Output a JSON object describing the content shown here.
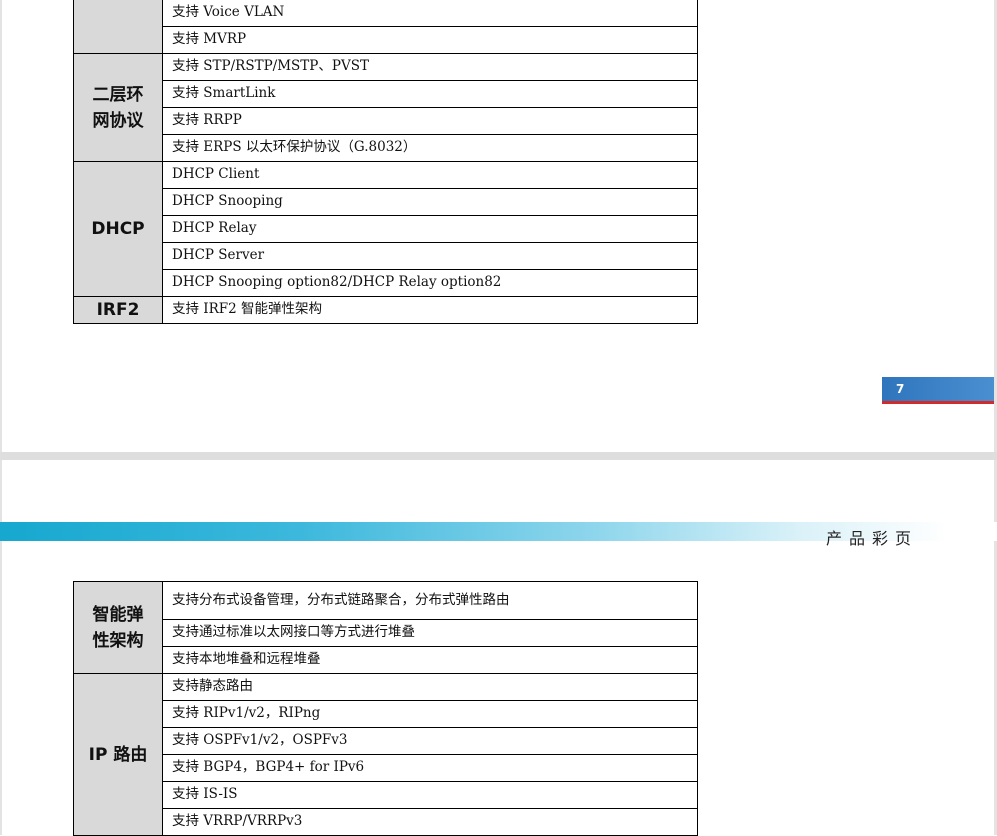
{
  "top_page": {
    "rows": [
      {
        "category": "",
        "items": [
          "支持 Voice VLAN",
          "支持 MVRP"
        ]
      },
      {
        "category": "二层环网协议",
        "items": [
          "支持 STP/RSTP/MSTP、PVST",
          "支持 SmartLink",
          "支持 RRPP",
          "支持 ERPS 以太环保护协议（G.8032）"
        ]
      },
      {
        "category": "DHCP",
        "items": [
          "DHCP Client",
          "DHCP Snooping",
          "DHCP Relay",
          "DHCP Server",
          "DHCP Snooping option82/DHCP Relay option82"
        ]
      },
      {
        "category": "IRF2",
        "items": [
          "支持 IRF2 智能弹性架构"
        ]
      }
    ],
    "page_number": "7"
  },
  "bottom_page": {
    "header_title": "产品彩页",
    "rows": [
      {
        "category": "智能弹性架构",
        "items": [
          "支持分布式设备管理，分布式链路聚合，分布式弹性路由",
          "支持通过标准以太网接口等方式进行堆叠",
          "支持本地堆叠和远程堆叠"
        ]
      },
      {
        "category": "IP 路由",
        "items": [
          "支持静态路由",
          "支持 RIPv1/v2，RIPng",
          "支持 OSPFv1/v2，OSPFv3",
          "支持 BGP4，BGP4+ for IPv6",
          "支持 IS-IS",
          "支持 VRRP/VRRPv3"
        ]
      }
    ]
  },
  "colors": {
    "category_bg": "#d9d9d9",
    "page_number_bg": "#2f75bd",
    "page_number_line": "#d42a2a",
    "header_band": "#16a8cf"
  }
}
